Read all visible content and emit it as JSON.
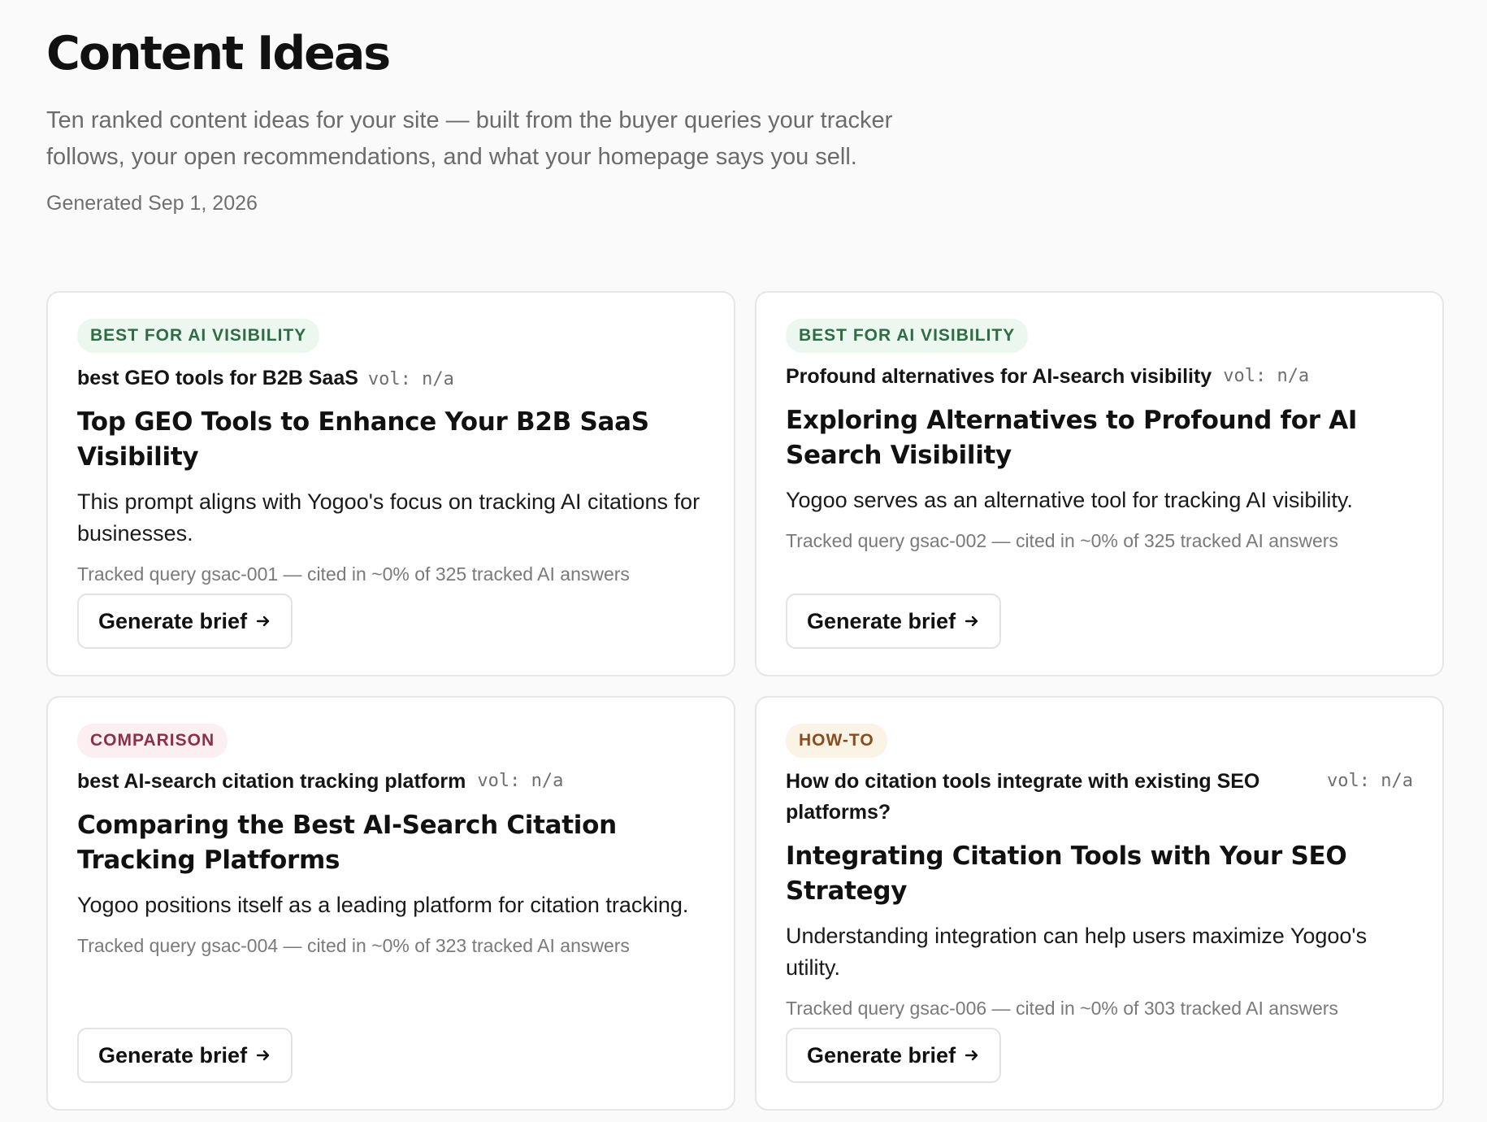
{
  "header": {
    "title": "Content Ideas",
    "subtitle": "Ten ranked content ideas for your site — built from the buyer queries your tracker follows, your open recommendations, and what your homepage says you sell.",
    "generated": "Generated Sep 1, 2026"
  },
  "colors": {
    "best_for_ai_bg": "#ecf8ef",
    "best_for_ai_fg": "#2f6b45",
    "comparison_bg": "#fbeff2",
    "comparison_fg": "#8b2f4c",
    "howto_bg": "#fbf4e6",
    "howto_fg": "#8a4b1d"
  },
  "cards": [
    {
      "badge": "BEST FOR AI VISIBILITY",
      "query": "best GEO tools for B2B SaaS",
      "vol": "vol: n/a",
      "title": "Top GEO Tools to Enhance Your B2B SaaS Visibility",
      "description": "This prompt aligns with Yogoo's focus on tracking AI citations for businesses.",
      "tracked": "Tracked query gsac-001 — cited in ~0% of 325 tracked AI answers",
      "button": "Generate brief"
    },
    {
      "badge": "BEST FOR AI VISIBILITY",
      "query": "Profound alternatives for AI-search visibility",
      "vol": "vol: n/a",
      "title": "Exploring Alternatives to Profound for AI Search Visibility",
      "description": "Yogoo serves as an alternative tool for tracking AI visibility.",
      "tracked": "Tracked query gsac-002 — cited in ~0% of 325 tracked AI answers",
      "button": "Generate brief"
    },
    {
      "badge": "COMPARISON",
      "query": "best AI-search citation tracking platform",
      "vol": "vol: n/a",
      "title": "Comparing the Best AI-Search Citation Tracking Platforms",
      "description": "Yogoo positions itself as a leading platform for citation tracking.",
      "tracked": "Tracked query gsac-004 — cited in ~0% of 323 tracked AI answers",
      "button": "Generate brief"
    },
    {
      "badge": "HOW-TO",
      "query": "How do citation tools integrate with existing SEO platforms?",
      "vol": "vol: n/a",
      "title": "Integrating Citation Tools with Your SEO Strategy",
      "description": "Understanding integration can help users maximize Yogoo's utility.",
      "tracked": "Tracked query gsac-006 — cited in ~0% of 303 tracked AI answers",
      "button": "Generate brief"
    }
  ]
}
